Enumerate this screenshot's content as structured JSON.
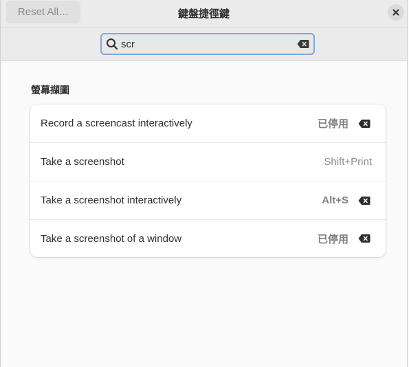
{
  "header": {
    "reset_label": "Reset All…",
    "title": "鍵盤捷徑鍵"
  },
  "search": {
    "value": "scr",
    "placeholder": ""
  },
  "section": {
    "title": "螢幕擷圖"
  },
  "shortcuts": [
    {
      "label": "Record a screencast interactively",
      "accel": "已停用",
      "has_reset": true
    },
    {
      "label": "Take a screenshot",
      "accel": "Shift+Print",
      "has_reset": false
    },
    {
      "label": "Take a screenshot interactively",
      "accel": "Alt+S",
      "has_reset": true
    },
    {
      "label": "Take a screenshot of a window",
      "accel": "已停用",
      "has_reset": true
    }
  ],
  "icons": {
    "close": "close-icon",
    "search": "search-icon",
    "clear": "clear-text-icon",
    "reset_shortcut": "backspace-icon"
  }
}
